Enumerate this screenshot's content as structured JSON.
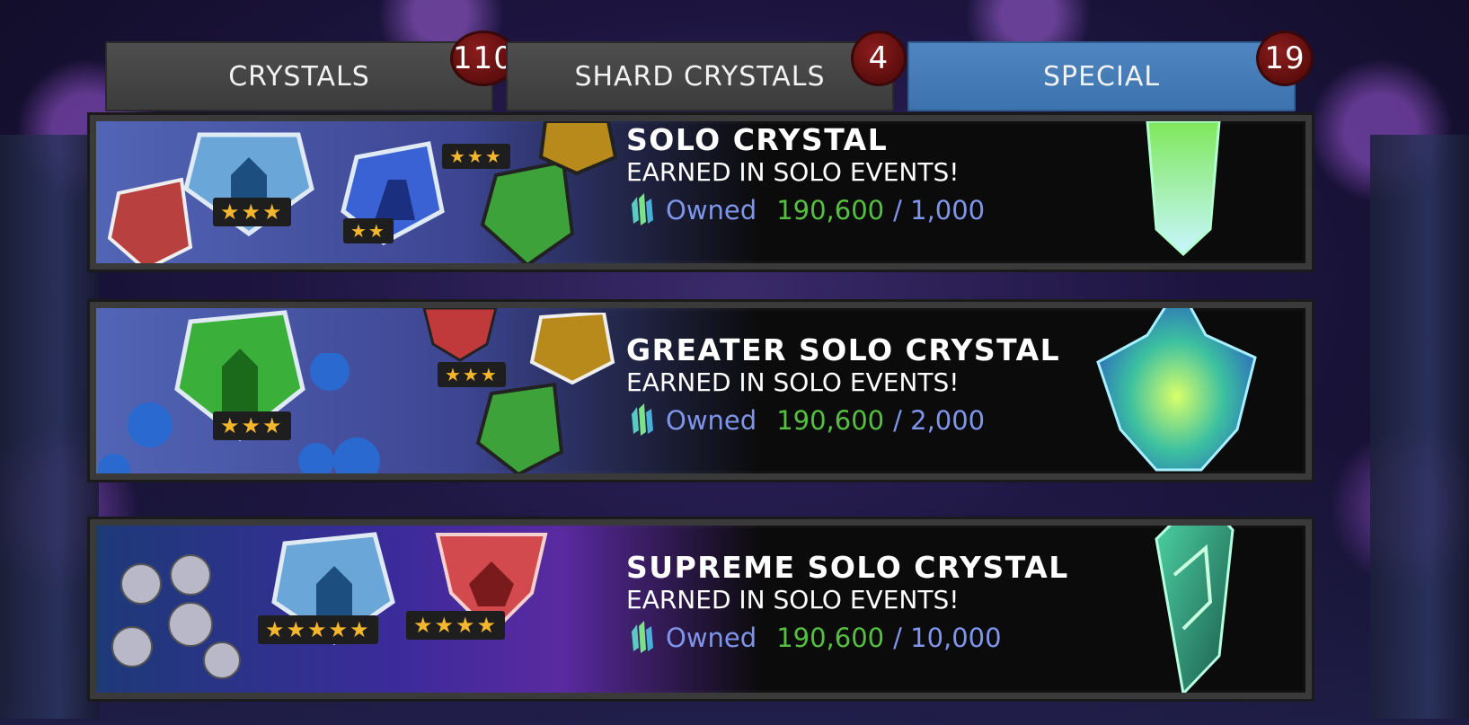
{
  "tabs": [
    {
      "label": "CRYSTALS",
      "badge": "110",
      "active": false
    },
    {
      "label": "SHARD CRYSTALS",
      "badge": "4",
      "active": false
    },
    {
      "label": "SPECIAL",
      "badge": "19",
      "active": true
    }
  ],
  "rows": [
    {
      "title": "SOLO CRYSTAL",
      "subtitle": "EARNED IN SOLO EVENTS!",
      "owned_label": "Owned",
      "owned_value": "190,600",
      "required": "/ 1,000",
      "crystal_icon": "green-shard-crystal-icon"
    },
    {
      "title": "GREATER SOLO CRYSTAL",
      "subtitle": "EARNED IN SOLO EVENTS!",
      "owned_label": "Owned",
      "owned_value": "190,600",
      "required": "/ 2,000",
      "crystal_icon": "green-cluster-crystal-icon"
    },
    {
      "title": "SUPREME SOLO CRYSTAL",
      "subtitle": "EARNED IN SOLO EVENTS!",
      "owned_label": "Owned",
      "owned_value": "190,600",
      "required": "/ 10,000",
      "crystal_icon": "green-diamond-crystal-icon"
    }
  ],
  "stars": {
    "three": "★★★",
    "two": "★★",
    "five": "★★★★★",
    "four": "★★★★"
  },
  "colors": {
    "active_tab": "#4a80bd",
    "inactive_tab": "#454545",
    "badge": "#6e1414",
    "owned_label": "#7f95ea",
    "owned_value": "#55c040"
  }
}
